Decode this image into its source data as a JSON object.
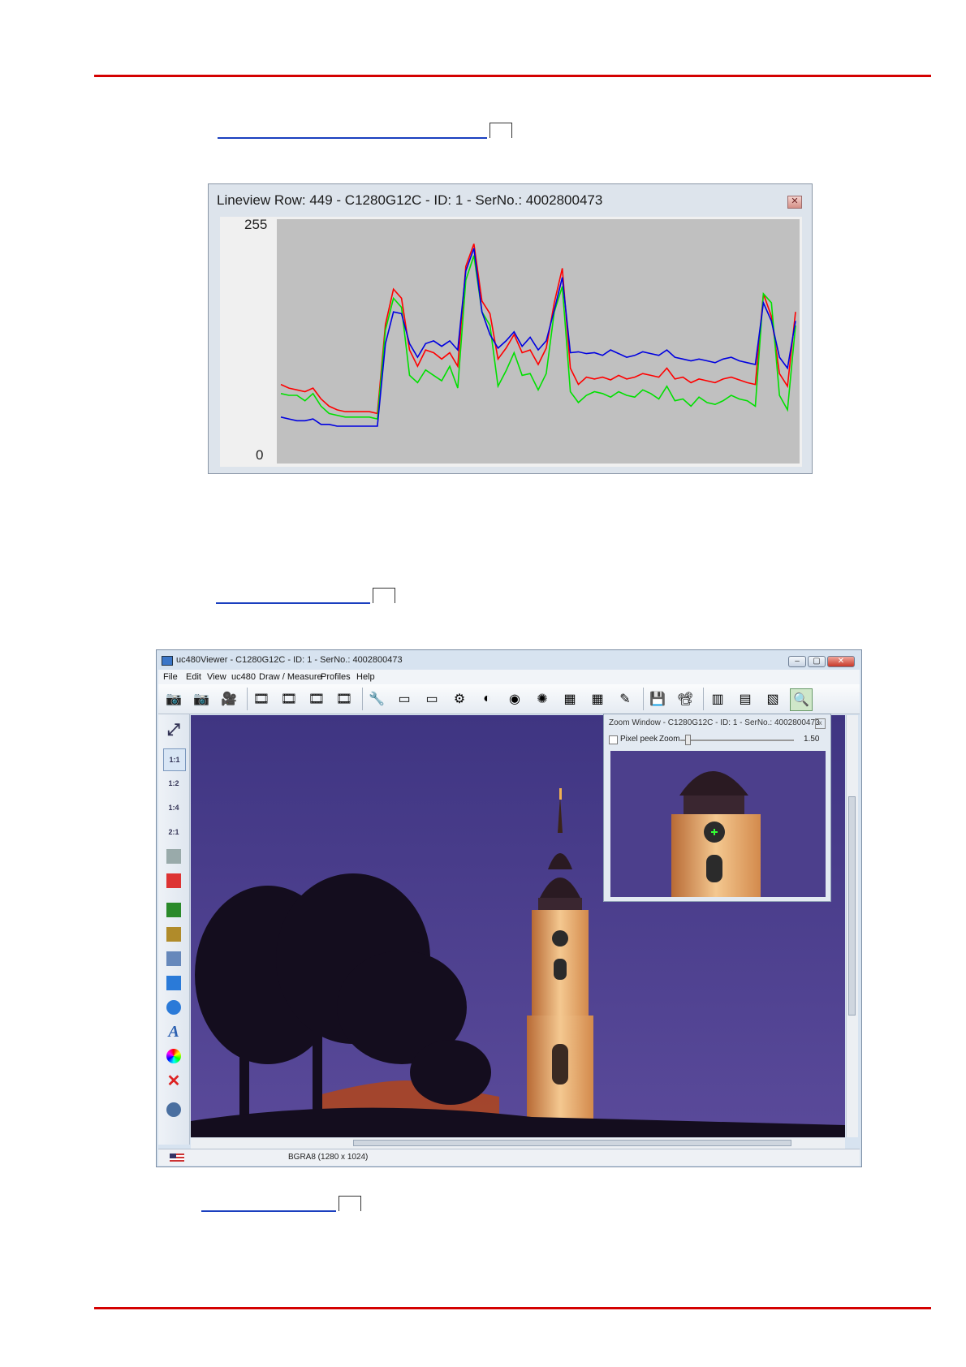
{
  "colors": {
    "rule": "#d40000",
    "link": "#1a3fbf",
    "series_red": "#ff0000",
    "series_green": "#00e000",
    "series_blue": "#0000e0",
    "plot_bg": "#c0c0c0",
    "sky": "#4a3f8a"
  },
  "lineview": {
    "title": "Lineview Row: 449 - C1280G12C - ID: 1 - SerNo.: 4002800473",
    "close_label": "✕",
    "ymax_label": "255",
    "ymin_label": "0"
  },
  "chart_data": {
    "type": "line",
    "ylim": [
      0,
      255
    ],
    "x": [
      0,
      10,
      20,
      30,
      40,
      50,
      60,
      70,
      80,
      90,
      100,
      110,
      120,
      130,
      140,
      150,
      160,
      170,
      180,
      190,
      200,
      210,
      220,
      230,
      240,
      250,
      260,
      270,
      280,
      290,
      300,
      310,
      320,
      330,
      340,
      350,
      360,
      370,
      380,
      390,
      400,
      410,
      420,
      430,
      440,
      450,
      460,
      470,
      480,
      490,
      500,
      510,
      520,
      530,
      540,
      550,
      560,
      570,
      580,
      590,
      600,
      610,
      620,
      630,
      640
    ],
    "series": [
      {
        "color": "red",
        "values": [
          80,
          76,
          74,
          72,
          76,
          64,
          56,
          52,
          50,
          50,
          50,
          50,
          48,
          146,
          185,
          175,
          118,
          100,
          118,
          115,
          108,
          115,
          100,
          210,
          235,
          172,
          158,
          108,
          120,
          135,
          115,
          118,
          102,
          120,
          170,
          208,
          98,
          80,
          88,
          86,
          88,
          85,
          90,
          86,
          88,
          92,
          90,
          88,
          98,
          86,
          88,
          82,
          86,
          84,
          82,
          86,
          88,
          85,
          82,
          80,
          180,
          155,
          92,
          78,
          160
        ]
      },
      {
        "color": "green",
        "values": [
          70,
          68,
          68,
          62,
          70,
          56,
          48,
          46,
          44,
          44,
          44,
          44,
          42,
          140,
          175,
          165,
          90,
          82,
          96,
          90,
          84,
          100,
          76,
          195,
          222,
          160,
          145,
          78,
          95,
          115,
          90,
          92,
          74,
          92,
          160,
          188,
          72,
          60,
          68,
          72,
          70,
          66,
          72,
          68,
          66,
          74,
          70,
          64,
          78,
          62,
          64,
          56,
          66,
          60,
          58,
          62,
          68,
          64,
          62,
          56,
          180,
          170,
          68,
          52,
          145
        ]
      },
      {
        "color": "blue",
        "values": [
          44,
          42,
          40,
          40,
          42,
          36,
          36,
          34,
          34,
          34,
          34,
          34,
          34,
          125,
          160,
          158,
          125,
          110,
          125,
          128,
          122,
          128,
          118,
          205,
          230,
          160,
          135,
          120,
          128,
          138,
          122,
          132,
          118,
          128,
          162,
          198,
          115,
          116,
          114,
          115,
          112,
          118,
          114,
          110,
          112,
          116,
          114,
          112,
          118,
          110,
          108,
          106,
          108,
          106,
          104,
          108,
          110,
          106,
          104,
          102,
          170,
          150,
          110,
          98,
          150
        ]
      }
    ]
  },
  "viewer": {
    "title": "uc480Viewer - C1280G12C - ID: 1 - SerNo.: 4002800473",
    "min_label": "–",
    "max_label": "▢",
    "close_label": "✕",
    "menu": [
      "File",
      "Edit",
      "View",
      "uc480",
      "Draw / Measure",
      "Profiles",
      "Help"
    ],
    "toolbar_icons": [
      "camera-open-icon",
      "camera-close-icon",
      "camera-live-icon",
      "film-icon",
      "film-record-icon",
      "film-play-icon",
      "film-settings-icon",
      "wrench-icon",
      "aoi-icon",
      "aoi-delete-icon",
      "gear-icon",
      "circle-half-icon",
      "bulb-icon",
      "color-wheel-icon",
      "color-grid-icon",
      "color-grid-delete-icon",
      "pen-icon",
      "save-icon",
      "projector-icon",
      "histogram-icon",
      "line-view-icon",
      "column-view-icon",
      "zoom-window-icon"
    ],
    "left_tools": [
      {
        "name": "fit-window-icon",
        "label": "⤢"
      },
      {
        "name": "zoom-1-1-icon",
        "label": "1:1"
      },
      {
        "name": "zoom-1-2-icon",
        "label": "1:2"
      },
      {
        "name": "zoom-1-4-icon",
        "label": "1:4"
      },
      {
        "name": "zoom-2-1-icon",
        "label": "2:1"
      },
      {
        "name": "monitor-icon",
        "label": ""
      },
      {
        "name": "monitor-off-icon",
        "label": ""
      },
      {
        "name": "pencil-icon",
        "label": ""
      },
      {
        "name": "measure-icon",
        "label": ""
      },
      {
        "name": "magnifier-icon",
        "label": ""
      },
      {
        "name": "rectangle-icon",
        "label": ""
      },
      {
        "name": "circle-icon",
        "label": ""
      },
      {
        "name": "text-icon",
        "label": "A"
      },
      {
        "name": "color-picker-icon",
        "label": ""
      },
      {
        "name": "delete-icon",
        "label": "✕"
      },
      {
        "name": "clock-icon",
        "label": ""
      }
    ],
    "status_format": "BGRA8 (1280 x 1024)",
    "zoom_window": {
      "title": "Zoom Window - C1280G12C - ID: 1 - SerNo.: 4002800473",
      "close_label": "x",
      "pixel_peek_label": "Pixel peek",
      "zoom_label": "Zoom",
      "zoom_value": "1.50"
    }
  }
}
